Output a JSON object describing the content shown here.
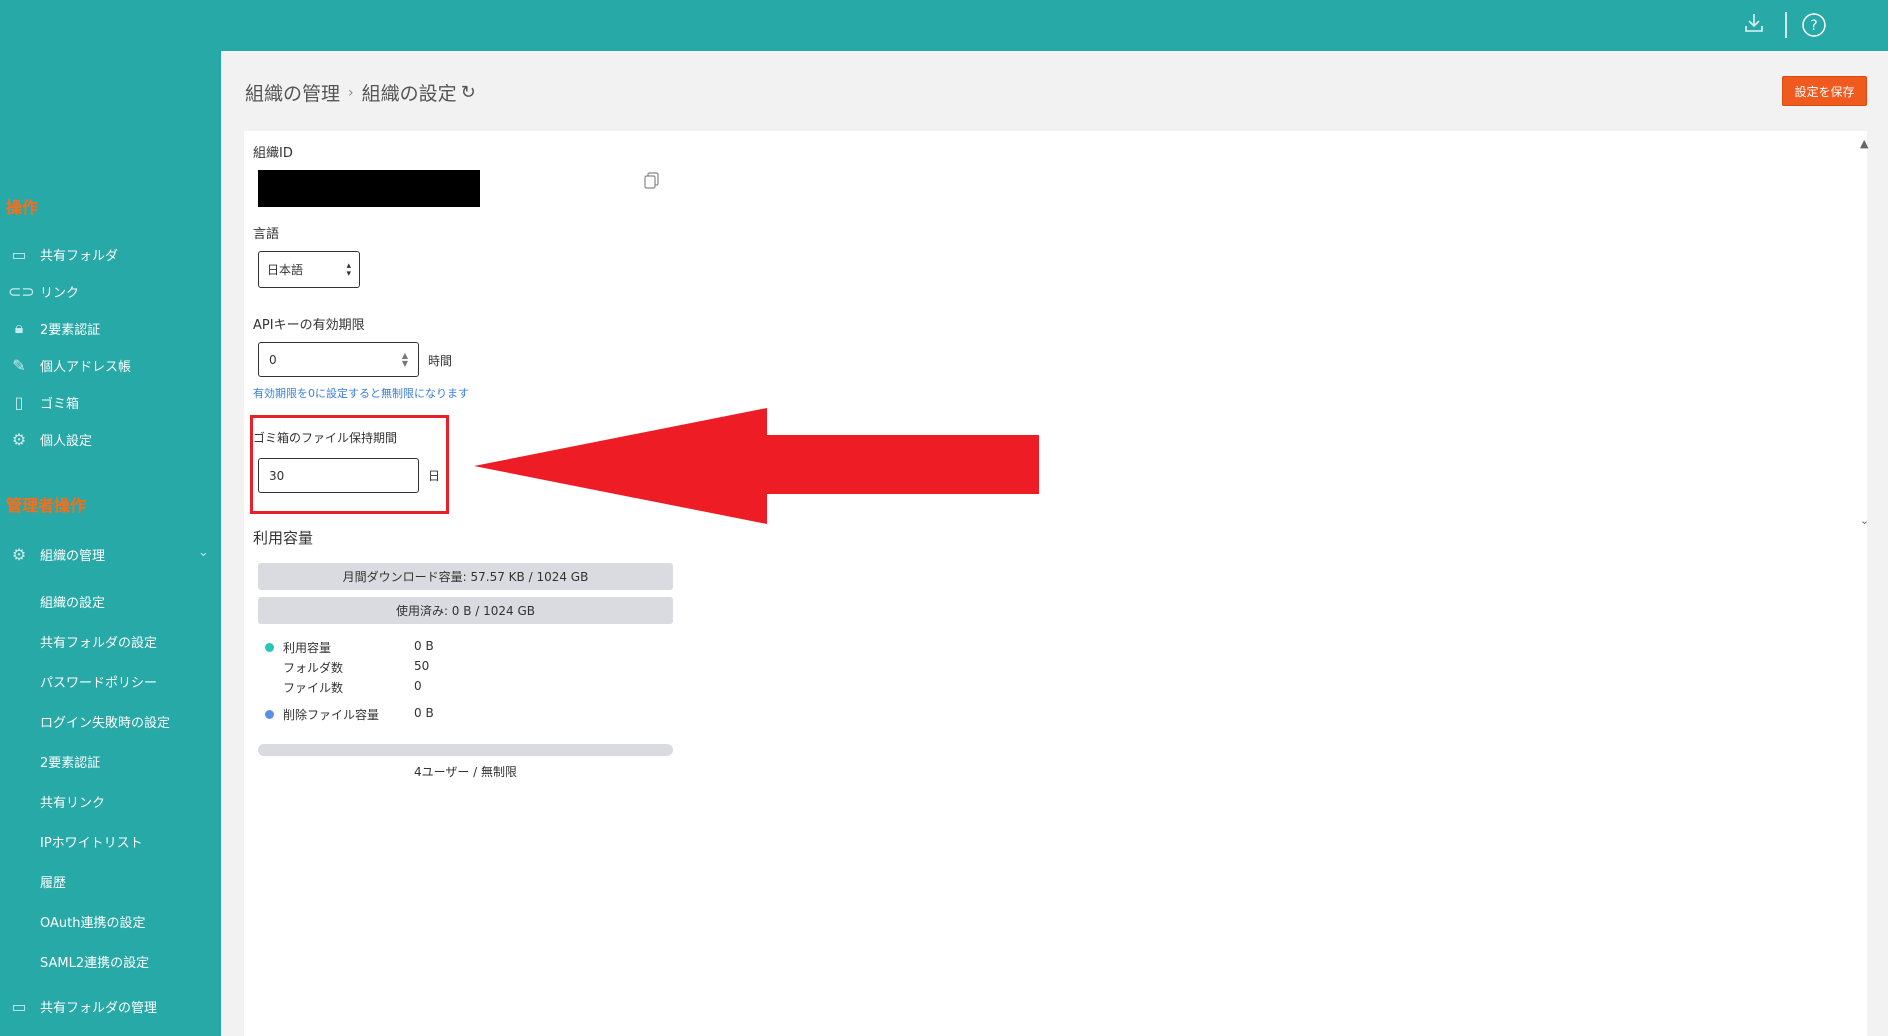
{
  "topbar": {
    "download_icon": "download-icon",
    "help_icon": "help-icon"
  },
  "sidebar": {
    "section_ops": "操作",
    "ops_items": [
      {
        "label": "共有フォルダ",
        "icon": "shared-folder-icon"
      },
      {
        "label": "リンク",
        "icon": "link-icon"
      },
      {
        "label": "2要素認証",
        "icon": "lock-icon"
      },
      {
        "label": "個人アドレス帳",
        "icon": "edit-icon"
      },
      {
        "label": "ゴミ箱",
        "icon": "trash-icon"
      },
      {
        "label": "個人設定",
        "icon": "gear-icon"
      }
    ],
    "section_admin": "管理者操作",
    "org_manage": "組織の管理",
    "org_sub": [
      "組織の設定",
      "共有フォルダの設定",
      "パスワードポリシー",
      "ログイン失敗時の設定",
      "2要素認証",
      "共有リンク",
      "IPホワイトリスト",
      "履歴",
      "OAuth連携の設定",
      "SAML2連携の設定"
    ],
    "shared_folder_manage": "共有フォルダの管理"
  },
  "header": {
    "breadcrumb_parent": "組織の管理",
    "breadcrumb_current": "組織の設定",
    "save_button": "設定を保存"
  },
  "form": {
    "org_id_label": "組織ID",
    "language_label": "言語",
    "language_value": "日本語",
    "api_key_label": "APIキーの有効期限",
    "api_key_value": "0",
    "api_key_unit": "時間",
    "api_key_hint": "有効期限を0に設定すると無制限になります",
    "trash_retention_label": "ゴミ箱のファイル保持期間",
    "trash_retention_value": "30",
    "trash_retention_unit": "日"
  },
  "usage": {
    "title": "利用容量",
    "monthly_download_bar": "月間ダウンロード容量: 57.57 KB / 1024 GB",
    "used_bar": "使用済み: 0 B / 1024 GB",
    "used_label": "利用容量",
    "used_value": "0 B",
    "folder_count_label": "フォルダ数",
    "folder_count_value": "50",
    "file_count_label": "ファイル数",
    "file_count_value": "0",
    "deleted_label": "削除ファイル容量",
    "deleted_value": "0 B",
    "users_text": "4ユーザー / 無制限",
    "colors": {
      "used": "#26c6b8",
      "deleted": "#5b8ee6"
    }
  },
  "annotation": {
    "highlight_color": "#e8202a",
    "arrow_color": "#ee1c25"
  }
}
